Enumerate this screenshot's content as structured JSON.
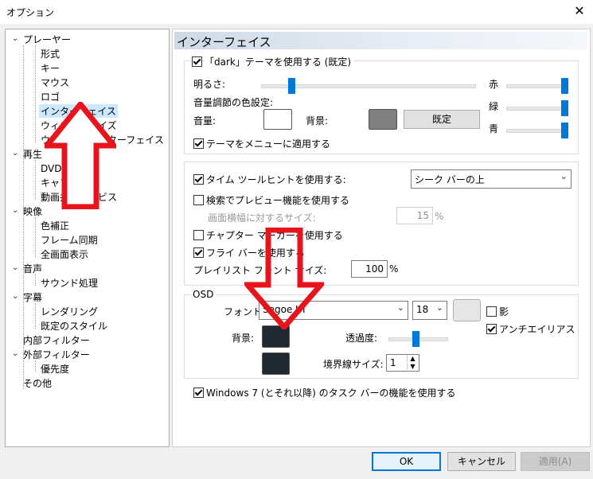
{
  "window": {
    "title": "オプション",
    "close_icon": "close-icon"
  },
  "tree": {
    "items": [
      {
        "label": "プレーヤー",
        "expander": "⌄"
      },
      {
        "label": "形式"
      },
      {
        "label": "キー"
      },
      {
        "label": "マウス"
      },
      {
        "label": "ロゴ"
      },
      {
        "label": "インターフェイス"
      },
      {
        "label": "ウィンドウサイズ"
      },
      {
        "label": "ウィンドウインターフェイス"
      },
      {
        "label": "再生",
        "expander": "⌄"
      },
      {
        "label": "DVD ビデオ"
      },
      {
        "label": "キャプチャ"
      },
      {
        "label": "動画共有サービス"
      },
      {
        "label": "映像",
        "expander": "⌄"
      },
      {
        "label": "色補正"
      },
      {
        "label": "フレーム同期"
      },
      {
        "label": "全画面表示"
      },
      {
        "label": "音声",
        "expander": "⌄"
      },
      {
        "label": "サウンド処理"
      },
      {
        "label": "字幕",
        "expander": "⌄"
      },
      {
        "label": "レンダリング"
      },
      {
        "label": "既定のスタイル"
      },
      {
        "label": "内部フィルター"
      },
      {
        "label": "外部フィルター",
        "expander": "⌄"
      },
      {
        "label": "優先度"
      },
      {
        "label": "その他"
      }
    ]
  },
  "page": {
    "title": "インターフェイス"
  },
  "theme_group": {
    "dark_theme_label": "「dark」テーマを使用する (既定)",
    "dark_theme_checked": true,
    "brightness_label": "明るさ:",
    "volume_color_label": "音量調節の色設定:",
    "volume_label": "音量:",
    "background_label": "背景:",
    "default_button": "既定",
    "red_label": "赤",
    "green_label": "緑",
    "blue_label": "青",
    "apply_menu_label": "テーマをメニューに適用する",
    "apply_menu_checked": true,
    "volume_color": "#ffffff",
    "background_color": "#808080"
  },
  "seek_group": {
    "tooltip_label": "タイム ツールヒントを使用する:",
    "tooltip_checked": true,
    "tooltip_position": "シーク バーの上",
    "preview_label": "検索でプレビュー機能を使用する",
    "preview_checked": false,
    "preview_size_label": "画面横幅に対するサイズ:",
    "preview_size_value": "15",
    "percent": "%",
    "chapter_label": "チャプター マーカーを使用する",
    "chapter_checked": false,
    "flybar_label": "フライ バーを使用する",
    "flybar_checked": true,
    "playlist_font_label": "プレイリスト フォント サイズ:",
    "playlist_font_value": "100",
    "percent2": "%"
  },
  "osd_group": {
    "legend": "OSD",
    "font_label": "フォント:",
    "font_value": "Segoe UI",
    "size_value": "18",
    "shadow_label": "影",
    "shadow_checked": false,
    "antialias_label": "アンチエイリアス",
    "antialias_checked": true,
    "background_label": "背景:",
    "opacity_label": "透過度:",
    "border_label": "境界線サイズ:",
    "border_value": "1",
    "font_color": "#e6e6e6",
    "bg_color": "#202830",
    "border_color": "#202830"
  },
  "taskbar": {
    "label": "Windows 7 (とそれ以降) のタスク バーの機能を使用する",
    "checked": true
  },
  "buttons": {
    "ok": "OK",
    "cancel": "キャンセル",
    "apply": "適用(A)"
  },
  "annotations": {
    "arrow_color": "#e8141c"
  },
  "sliders": {
    "brightness": 0.13,
    "red": 1.0,
    "green": 1.0,
    "blue": 1.0,
    "opacity": 0.45
  }
}
